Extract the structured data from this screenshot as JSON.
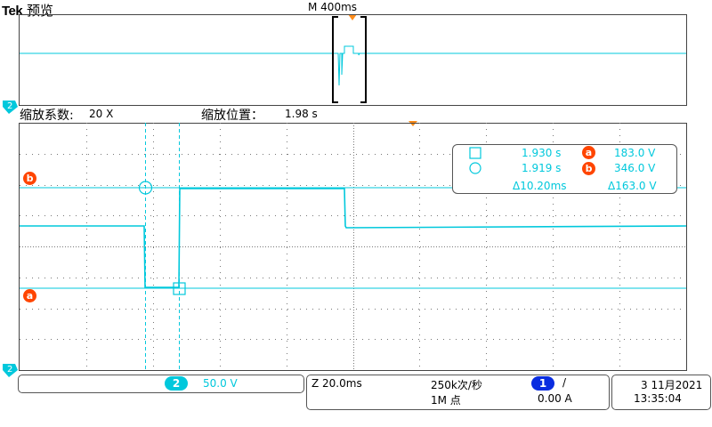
{
  "header": {
    "brand": "Tek",
    "mode": "预览",
    "timebase_marker": "M 400ms"
  },
  "zoom": {
    "factor_label": "缩放系数:",
    "factor_value": "20 X",
    "position_label": "缩放位置：",
    "position_value": "1.98 s"
  },
  "channel_markers": {
    "ch2_marker": "2",
    "cursor_a": "a",
    "cursor_b": "b"
  },
  "cursor_readout": {
    "square_time": "1.930 s",
    "a_value": "183.0 V",
    "circle_time": "1.919 s",
    "b_value": "346.0 V",
    "delta_time": "Δ10.20ms",
    "delta_value": "Δ163.0 V",
    "a_label": "a",
    "b_label": "b"
  },
  "status": {
    "channel_badge": "2",
    "volts_per_div": "50.0 V",
    "zoom_timebase": "Z 20.0ms",
    "sample_rate": "250k次/秒",
    "record_length": "1M 点",
    "trigger_source": "1",
    "trigger_slope": "/",
    "trigger_level": "0.00 A",
    "date": "3 11月2021",
    "time": "13:35:04"
  },
  "colors": {
    "trace": "#00c8dc",
    "cursor_marker": "#ff4500",
    "trigger_badge": "#0a2de0",
    "trigger_pointer": "#ff8c1a"
  }
}
